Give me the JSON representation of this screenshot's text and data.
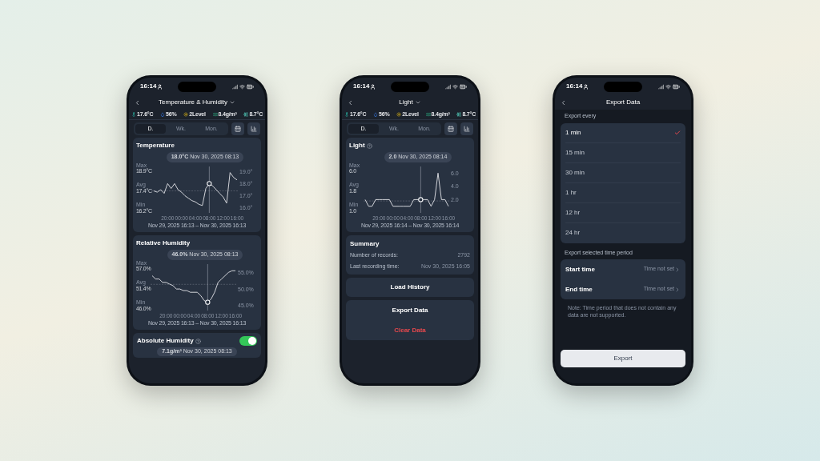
{
  "phones": [
    {
      "kind": "sensor",
      "time": "16:14",
      "header": {
        "title": "Temperature & Humidity",
        "dropdown": true
      },
      "stats": [
        {
          "kind": "temperature",
          "value": "17.6°C"
        },
        {
          "kind": "humidity",
          "value": "56%"
        },
        {
          "kind": "light",
          "value": "2Level"
        },
        {
          "kind": "absolute",
          "value": "8.4g/m³"
        },
        {
          "kind": "dew",
          "value": "8.7°C"
        }
      ],
      "range_tabs": [
        {
          "label": "D.",
          "selected": true
        },
        {
          "label": "Wk.",
          "selected": false
        },
        {
          "label": "Mon.",
          "selected": false
        }
      ],
      "cards": [
        {
          "kind": "chart",
          "title": "Temperature",
          "help": false,
          "tooltip": "**18.0°C** Nov 30, 2025 08:13",
          "readings": [
            {
              "label": "Max",
              "value": "18.9°C"
            },
            {
              "label": "Avg",
              "value": "17.4°C"
            },
            {
              "label": "Min",
              "value": "16.2°C"
            }
          ],
          "range": "Nov 29, 2025 16:13 – Nov 30, 2025 16:13",
          "chart_data": {
            "type": "line",
            "categories": [
              null,
              null,
              null,
              null,
              "20:00",
              null,
              null,
              null,
              "00:00",
              null,
              null,
              null,
              "04:00",
              null,
              null,
              null,
              "08:00",
              null,
              null,
              null,
              "12:00",
              null,
              null,
              null,
              "16:00"
            ],
            "ylim": [
              15.6,
              19.4
            ],
            "series": [
              {
                "color": "#e5e7eb",
                "values": [
                  17.4,
                  17.3,
                  17.5,
                  17.2,
                  18.0,
                  17.6,
                  18.0,
                  17.5,
                  17.3,
                  17.0,
                  16.8,
                  16.6,
                  16.5,
                  16.3,
                  16.2,
                  17.6,
                  18.0,
                  17.8,
                  17.5,
                  17.2,
                  16.9,
                  16.4,
                  18.9,
                  18.5,
                  18.3
                ]
              }
            ],
            "yticks": [
              {
                "value": 16,
                "label": "16.0°"
              },
              {
                "value": 17,
                "label": "17.0°"
              },
              {
                "value": 18,
                "label": "18.0°"
              },
              {
                "value": 19,
                "label": "19.0°"
              }
            ],
            "ref_lines": [
              {
                "axis": "y",
                "value": 17.4
              }
            ],
            "annotations": [
              {
                "x": "08:00"
              }
            ]
          }
        },
        {
          "kind": "chart",
          "title": "Relative Humidity",
          "help": false,
          "tooltip": "**46.0%** Nov 30, 2025 08:13",
          "readings": [
            {
              "label": "Max",
              "value": "57.0%"
            },
            {
              "label": "Avg",
              "value": "51.4%"
            },
            {
              "label": "Min",
              "value": "46.0%"
            }
          ],
          "range": "Nov 29, 2025 16:13 – Nov 30, 2025 16:13",
          "chart_data": {
            "type": "line",
            "categories": [
              null,
              null,
              null,
              null,
              "20:00",
              null,
              null,
              null,
              "00:00",
              null,
              null,
              null,
              "04:00",
              null,
              null,
              null,
              "08:00",
              null,
              null,
              null,
              "12:00",
              null,
              null,
              null,
              "16:00"
            ],
            "ylim": [
              43.5,
              57.5
            ],
            "series": [
              {
                "color": "#e5e7eb",
                "values": [
                  54.0,
                  53.0,
                  53.0,
                  52.0,
                  52.0,
                  51.5,
                  51.0,
                  50.0,
                  50.0,
                  49.5,
                  49.5,
                  49.0,
                  49.0,
                  49.0,
                  48.0,
                  46.5,
                  46.0,
                  47.0,
                  49.0,
                  52.0,
                  53.0,
                  54.0,
                  55.0,
                  55.5,
                  55.5
                ]
              }
            ],
            "yticks": [
              {
                "value": 45,
                "label": "45.0%"
              },
              {
                "value": 50,
                "label": "50.0%"
              },
              {
                "value": 55,
                "label": "55.0%"
              }
            ],
            "ref_lines": [
              {
                "axis": "y",
                "value": 51.4
              }
            ],
            "annotations": [
              {
                "x": "08:00"
              }
            ]
          }
        },
        {
          "kind": "toggle",
          "title": "Absolute Humidity",
          "help": true,
          "on": true,
          "tooltip": "**7.1g/m³** Nov 30, 2025 08:13"
        }
      ]
    },
    {
      "kind": "sensor",
      "time": "16:14",
      "header": {
        "title": "Light",
        "dropdown": true
      },
      "stats": [
        {
          "kind": "temperature",
          "value": "17.6°C"
        },
        {
          "kind": "humidity",
          "value": "56%"
        },
        {
          "kind": "light",
          "value": "2Level"
        },
        {
          "kind": "absolute",
          "value": "8.4g/m³"
        },
        {
          "kind": "dew",
          "value": "8.7°C"
        }
      ],
      "range_tabs": [
        {
          "label": "D.",
          "selected": true
        },
        {
          "label": "Wk.",
          "selected": false
        },
        {
          "label": "Mon.",
          "selected": false
        }
      ],
      "cards": [
        {
          "kind": "chart",
          "title": "Light",
          "help": true,
          "tooltip": "**2.0** Nov 30, 2025 08:14",
          "readings": [
            {
              "label": "Max",
              "value": "6.0"
            },
            {
              "label": "Avg",
              "value": "1.8"
            },
            {
              "label": "Min",
              "value": "1.0"
            }
          ],
          "range": "Nov 29, 2025 16:14 – Nov 30, 2025 16:14",
          "chart_data": {
            "type": "line",
            "categories": [
              null,
              null,
              null,
              null,
              "20:00",
              null,
              null,
              null,
              "00:00",
              null,
              null,
              null,
              "04:00",
              null,
              null,
              null,
              "08:00",
              null,
              null,
              null,
              "12:00",
              null,
              null,
              null,
              "16:00"
            ],
            "ylim": [
              0,
              7
            ],
            "series": [
              {
                "color": "#e5e7eb",
                "values": [
                  2,
                  1,
                  1,
                  2,
                  2,
                  2,
                  2,
                  2,
                  1,
                  1,
                  1,
                  1,
                  1,
                  1,
                  2,
                  2,
                  2,
                  2,
                  2,
                  1,
                  2,
                  6,
                  2,
                  2,
                  1
                ]
              }
            ],
            "yticks": [
              {
                "value": 2,
                "label": "2.0"
              },
              {
                "value": 4,
                "label": "4.0"
              },
              {
                "value": 6,
                "label": "6.0"
              }
            ],
            "ref_lines": [
              {
                "axis": "y",
                "value": 1.8
              }
            ],
            "annotations": [
              {
                "x": "08:00"
              }
            ]
          }
        },
        {
          "kind": "summary",
          "title": "Summary",
          "rows": [
            {
              "label": "Number of records:",
              "value": "2792"
            },
            {
              "label": "Last recording time:",
              "value": "Nov 30, 2025 16:05"
            }
          ]
        },
        {
          "kind": "button",
          "label": "Load History"
        },
        {
          "kind": "actions",
          "items": [
            {
              "label": "Export Data",
              "kind": "normal"
            },
            {
              "label": "Clear Data",
              "kind": "danger"
            }
          ]
        }
      ]
    },
    {
      "kind": "export",
      "time": "16:14",
      "header": {
        "title": "Export Data",
        "dropdown": false
      },
      "section_1": "Export every",
      "options": [
        {
          "label": "1 min",
          "selected": true
        },
        {
          "label": "15 min",
          "selected": false
        },
        {
          "label": "30 min",
          "selected": false
        },
        {
          "label": "1 hr",
          "selected": false
        },
        {
          "label": "12 hr",
          "selected": false
        },
        {
          "label": "24 hr",
          "selected": false
        }
      ],
      "section_2": "Export selected time period",
      "time_rows": [
        {
          "label": "Start time",
          "value": "Time not set"
        },
        {
          "label": "End time",
          "value": "Time not set"
        }
      ],
      "note": "Note: Time period that does not contain any data are not supported.",
      "button": "Export"
    }
  ]
}
